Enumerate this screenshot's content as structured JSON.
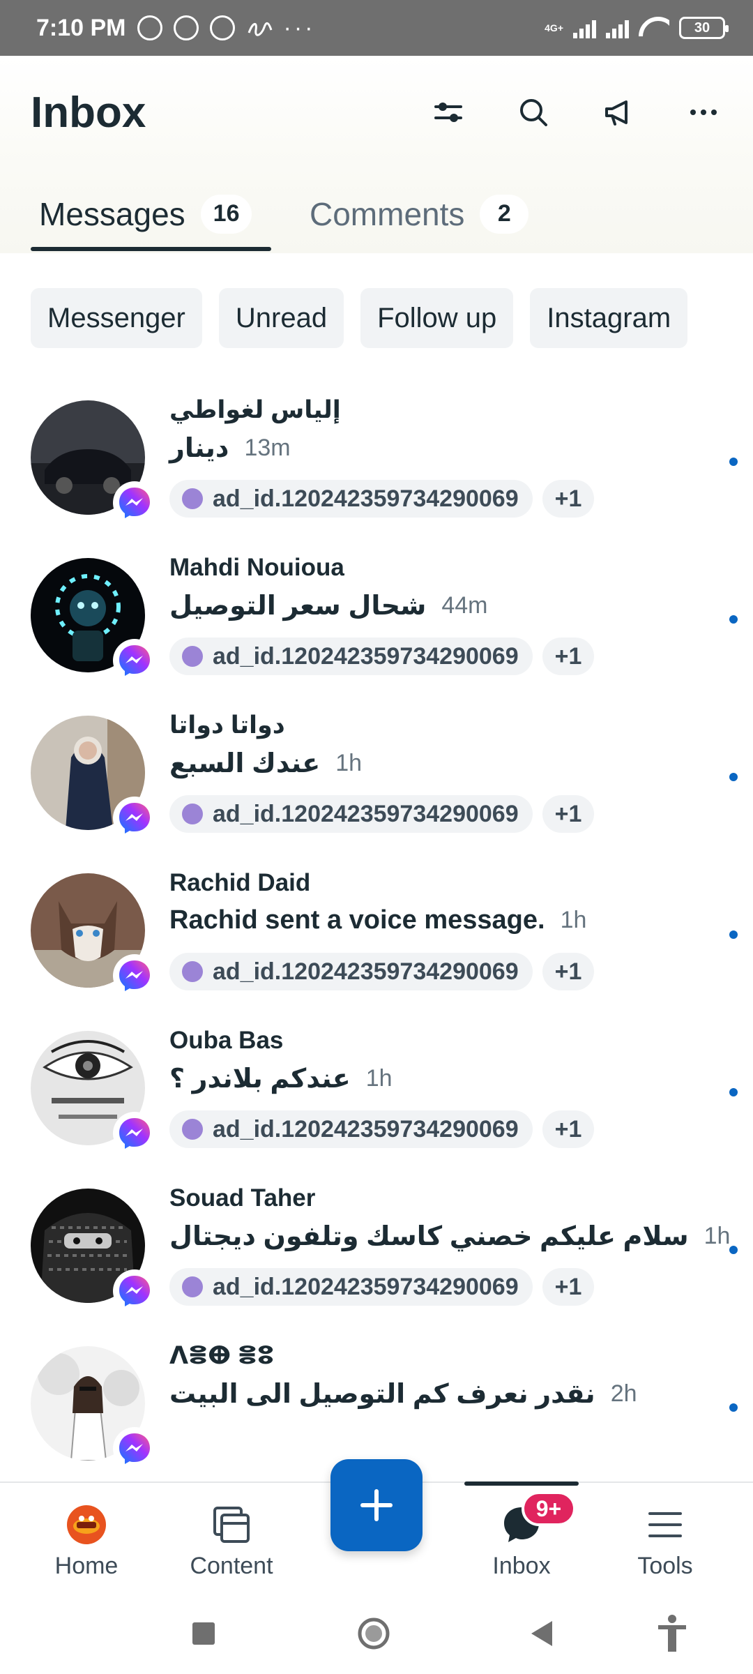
{
  "status_bar": {
    "time": "7:10 PM",
    "network": "4G+",
    "battery": "30",
    "more": "···"
  },
  "header": {
    "title": "Inbox",
    "icons": [
      "filter-sliders-icon",
      "search-icon",
      "megaphone-icon",
      "more-icon"
    ]
  },
  "tabs": [
    {
      "label": "Messages",
      "count": "16",
      "active": true
    },
    {
      "label": "Comments",
      "count": "2",
      "active": false
    }
  ],
  "filters": [
    "Messenger",
    "Unread",
    "Follow up",
    "Instagram"
  ],
  "conversations": [
    {
      "name": "إلياس لغواطي",
      "message": "دينار",
      "time": "13m",
      "tag": "ad_id.120242359734290069",
      "more": "+1"
    },
    {
      "name": "Mahdi Nouioua",
      "message": "شحال سعر التوصيل",
      "time": "44m",
      "tag": "ad_id.120242359734290069",
      "more": "+1"
    },
    {
      "name": "دواتا دواتا",
      "message": "عندك السبع",
      "time": "1h",
      "tag": "ad_id.120242359734290069",
      "more": "+1"
    },
    {
      "name": "Rachid Daid",
      "message": "Rachid sent a voice message.",
      "time": "1h",
      "tag": "ad_id.120242359734290069",
      "more": "+1"
    },
    {
      "name": "Ouba Bas",
      "message": "عندكم بلاندر ؟",
      "time": "1h",
      "tag": "ad_id.120242359734290069",
      "more": "+1"
    },
    {
      "name": "Souad Taher",
      "message": "سلام عليكم خصني كاسك وتلفون ديجتال",
      "time": "1h",
      "tag": "ad_id.120242359734290069",
      "more": "+1"
    },
    {
      "name": "ⴷⴻⴲ ⴻⵓ",
      "message": "نقدر نعرف كم التوصيل الى البيت",
      "time": "2h"
    }
  ],
  "bottom_nav": {
    "home": "Home",
    "content": "Content",
    "inbox": "Inbox",
    "inbox_badge": "9+",
    "tools": "Tools"
  },
  "colors": {
    "accent": "#0a66c2",
    "badge": "#e0245e",
    "tag_dot": "#9b84d6",
    "text": "#1c2b33"
  }
}
